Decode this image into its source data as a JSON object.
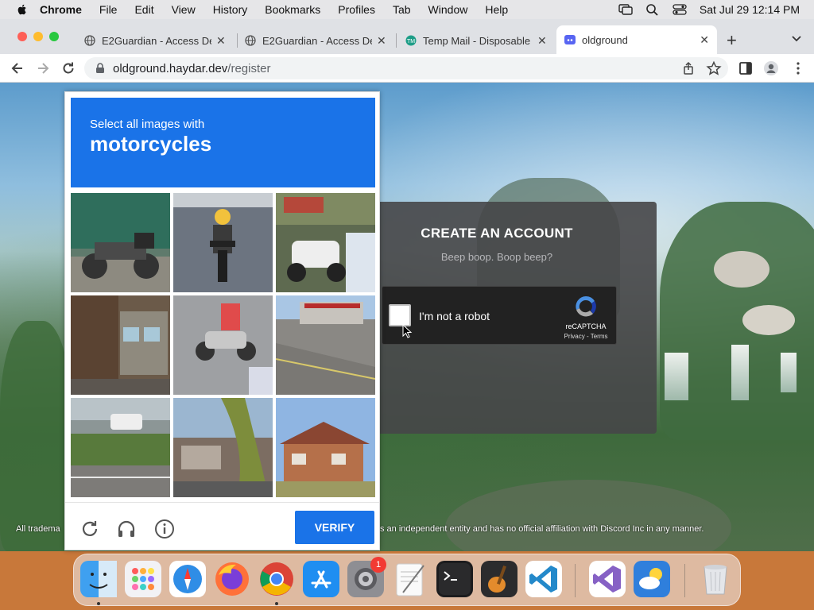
{
  "menubar": {
    "app_name": "Chrome",
    "items": [
      "File",
      "Edit",
      "View",
      "History",
      "Bookmarks",
      "Profiles",
      "Tab",
      "Window",
      "Help"
    ],
    "clock": "Sat Jul 29  12:14 PM"
  },
  "browser": {
    "tabs": [
      {
        "title": "E2Guardian - Access De",
        "icon": "globe-icon",
        "active": false
      },
      {
        "title": "E2Guardian - Access De",
        "icon": "globe-icon",
        "active": false
      },
      {
        "title": "Temp Mail - Disposable",
        "icon": "temp-mail-icon",
        "active": false
      },
      {
        "title": "oldground",
        "icon": "discord-icon",
        "active": true
      }
    ],
    "url_host": "oldground.haydar.dev",
    "url_path": "/register"
  },
  "page": {
    "card_heading": "CREATE AN ACCOUNT",
    "card_subtitle": "Beep boop. Boop beep?",
    "recaptcha": {
      "label": "I'm not a robot",
      "brand": "reCAPTCHA",
      "links": "Privacy - Terms"
    },
    "footer_left": "All tradema",
    "footer_right": "s an independent entity and has no official affiliation with Discord Inc in any manner."
  },
  "challenge": {
    "prompt_line1": "Select all images with",
    "prompt_target": "motorcycles",
    "verify_label": "VERIFY",
    "footer_icons": [
      "refresh-icon",
      "audio-challenge-icon",
      "info-icon"
    ],
    "accent_color": "#1a73e8"
  },
  "dock": {
    "apps": [
      "Finder",
      "Launchpad",
      "Safari",
      "Firefox",
      "Google Chrome",
      "App Store",
      "System Settings",
      "TextEdit",
      "Terminal",
      "GarageBand",
      "Visual Studio Code",
      "Visual Studio",
      "Weather",
      "Trash"
    ],
    "system_settings_badge": "1"
  }
}
